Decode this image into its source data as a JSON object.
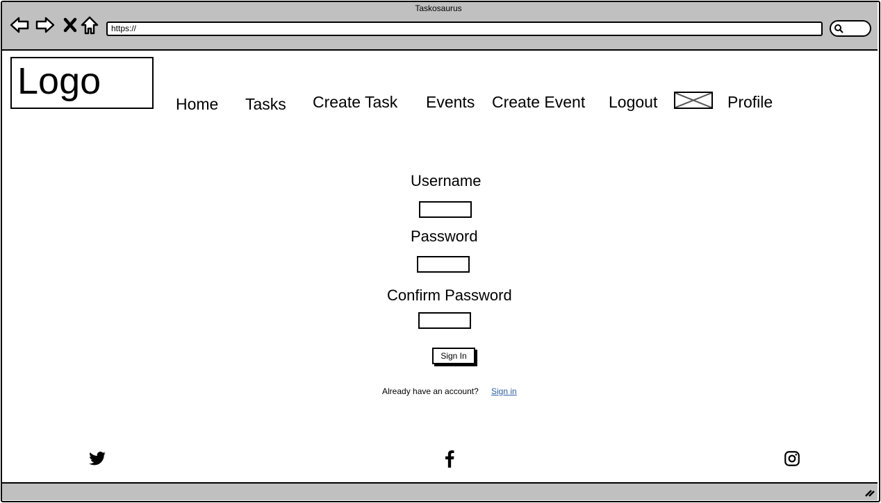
{
  "browser": {
    "title": "Taskosaurus",
    "url": "https://"
  },
  "header": {
    "logo": "Logo",
    "nav": [
      "Home",
      "Tasks",
      "Create Task",
      "Events",
      "Create Event",
      "Logout",
      "Profile"
    ]
  },
  "form": {
    "username_label": "Username",
    "password_label": "Password",
    "confirm_label": "Confirm Password",
    "submit_label": "Sign In",
    "already_text": "Already have an account?",
    "signin_link": "Sign in"
  },
  "footer": {
    "icons": [
      "twitter-icon",
      "facebook-icon",
      "instagram-icon"
    ]
  },
  "colors": {
    "chrome": "#c0c0c0",
    "link": "#2a5ea8"
  }
}
